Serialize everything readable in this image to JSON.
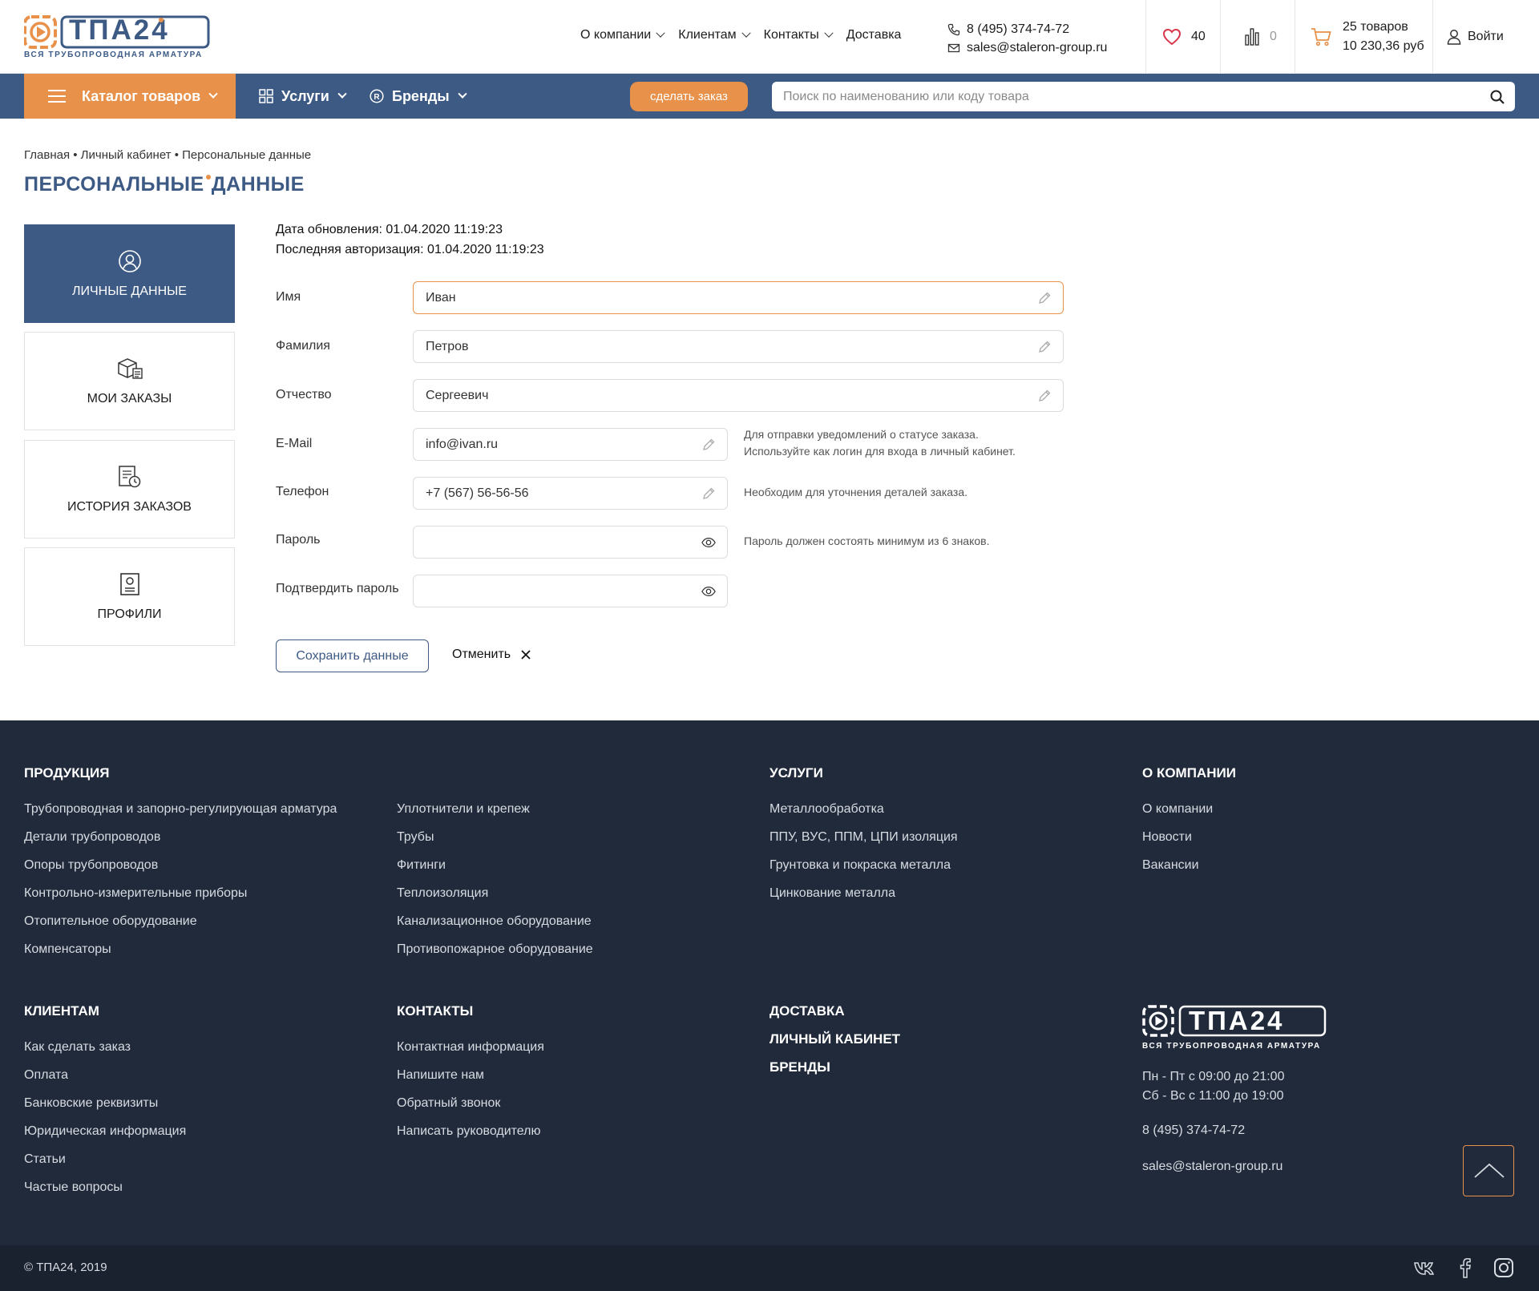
{
  "header": {
    "logo_text": "ТПА24",
    "logo_sub": "ВСЯ ТРУБОПРОВОДНАЯ АРМАТУРА",
    "nav": [
      {
        "label": "О компании",
        "dropdown": true
      },
      {
        "label": "Клиентам",
        "dropdown": true
      },
      {
        "label": "Контакты",
        "dropdown": true
      },
      {
        "label": "Доставка",
        "dropdown": false
      }
    ],
    "phone": "8 (495) 374-74-72",
    "email": "sales@staleron-group.ru",
    "favorites_count": "40",
    "compare_count": "0",
    "cart_count": "25 товаров",
    "cart_total": "10 230,36 руб",
    "login_label": "Войти",
    "accent_color": "#e8914a",
    "brand_color": "#3d5a85"
  },
  "bluebar": {
    "catalog_label": "Каталог товаров",
    "services_label": "Услуги",
    "brands_label": "Бренды",
    "order_button": "сделать заказ",
    "search_placeholder": "Поиск по наименованию или коду товара"
  },
  "page": {
    "breadcrumb": "Главная • Личный кабинет • Персональные данные",
    "title_part1": "ПЕРСОНАЛЬНЫЕ",
    "title_part2": "ДАННЫЕ"
  },
  "sidebar": {
    "items": [
      {
        "label": "ЛИЧНЫЕ ДАННЫЕ",
        "icon": "user-circle-icon",
        "active": true
      },
      {
        "label": "МОИ ЗАКАЗЫ",
        "icon": "boxes-icon",
        "active": false
      },
      {
        "label": "ИСТОРИЯ ЗАКАЗОВ",
        "icon": "history-doc-icon",
        "active": false
      },
      {
        "label": "ПРОФИЛИ",
        "icon": "profile-card-icon",
        "active": false
      }
    ]
  },
  "form": {
    "updated": "Дата обновления: 01.04.2020 11:19:23",
    "last_login": "Последняя авторизация: 01.04.2020 11:19:23",
    "first_name_label": "Имя",
    "first_name": "Иван",
    "last_name_label": "Фамилия",
    "last_name": "Петров",
    "middle_name_label": "Отчество",
    "middle_name": "Сергеевич",
    "email_label": "E-Mail",
    "email": "info@ivan.ru",
    "email_hint_1": "Для отправки уведомлений о статусе заказа.",
    "email_hint_2": "Используйте как логин для входа в личный кабинет.",
    "phone_label": "Телефон",
    "phone": "+7 (567) 56-56-56",
    "phone_hint": "Необходим для уточнения деталей заказа.",
    "password_label": "Пароль",
    "password_hint": "Пароль должен состоять минимум из 6 знаков.",
    "confirm_label": "Подтвердить пароль",
    "save_label": "Сохранить данные",
    "cancel_label": "Отменить"
  },
  "footer": {
    "products_title": "ПРОДУКЦИЯ",
    "products_col1": [
      "Трубопроводная и запорно-регулирующая арматура",
      "Детали трубопроводов",
      "Опоры трубопроводов",
      "Контрольно-измерительные приборы",
      "Отопительное оборудование",
      "Компенсаторы"
    ],
    "products_col2": [
      "Уплотнители и крепеж",
      "Трубы",
      "Фитинги",
      "Теплоизоляция",
      "Канализационное оборудование",
      "Противопожарное оборудование"
    ],
    "services_title": "УСЛУГИ",
    "services": [
      "Металлообработка",
      "ППУ, ВУС, ППМ, ЦПИ изоляция",
      "Грунтовка и покраска металла",
      "Цинкование металла"
    ],
    "company_title": "О КОМПАНИИ",
    "company": [
      "О компании",
      "Новости",
      "Вакансии"
    ],
    "clients_title": "КЛИЕНТАМ",
    "clients": [
      "Как сделать заказ",
      "Оплата",
      "Банковские реквизиты",
      "Юридическая информация",
      "Статьи",
      "Частые вопросы"
    ],
    "contacts_title": "КОНТАКТЫ",
    "contacts": [
      "Контактная информация",
      "Напишите нам",
      "Обратный звонок",
      "Написать руководителю"
    ],
    "extra_titles": [
      "ДОСТАВКА",
      "ЛИЧНЫЙ КАБИНЕТ",
      "БРЕНДЫ"
    ],
    "hours_1": "Пн - Пт с 09:00 до 21:00",
    "hours_2": "Сб - Вс с 11:00 до 19:00",
    "phone": "8 (495) 374-74-72",
    "email": "sales@staleron-group.ru",
    "copyright": "© ТПА24, 2019",
    "social": [
      "vk-icon",
      "facebook-icon",
      "instagram-icon"
    ]
  }
}
